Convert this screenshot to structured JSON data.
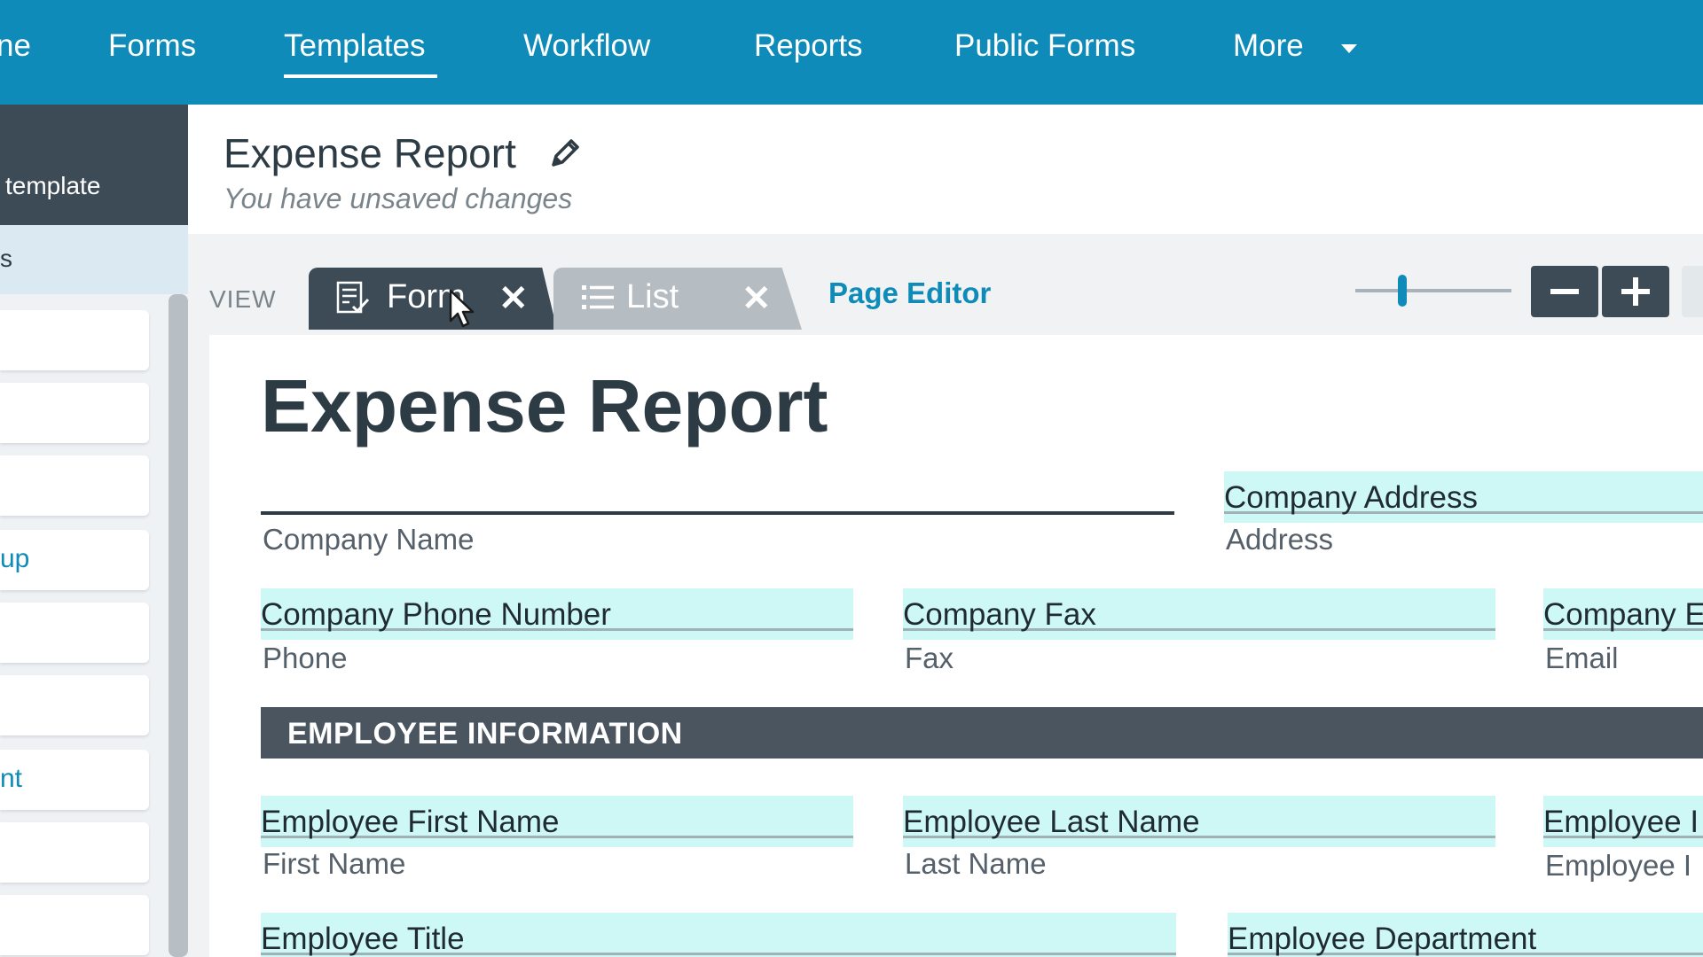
{
  "nav": {
    "items": [
      {
        "label": "ne"
      },
      {
        "label": "Forms"
      },
      {
        "label": "Templates"
      },
      {
        "label": "Workflow"
      },
      {
        "label": "Reports"
      },
      {
        "label": "Public Forms"
      },
      {
        "label": "More"
      }
    ],
    "active": "Templates"
  },
  "sidebar": {
    "header_label": "template",
    "selected_label": "s",
    "cards": [
      {
        "label": ""
      },
      {
        "label": ""
      },
      {
        "label": ""
      },
      {
        "label": "up"
      },
      {
        "label": ""
      },
      {
        "label": ""
      },
      {
        "label": "nt"
      },
      {
        "label": ""
      },
      {
        "label": ""
      }
    ]
  },
  "header": {
    "title": "Expense Report",
    "status": "You have unsaved changes"
  },
  "tabs": {
    "view_label": "VIEW",
    "form_label": "Form",
    "list_label": "List",
    "page_editor_label": "Page Editor",
    "zoom_level": 0.3
  },
  "form": {
    "title": "Expense Report",
    "company_name_label": "Company Name",
    "company_address_value": "Company Address",
    "company_address_label": "Address",
    "company_phone_value": "Company Phone Number",
    "company_phone_label": "Phone",
    "company_fax_value": "Company Fax",
    "company_fax_label": "Fax",
    "company_email_value": "Company E",
    "company_email_label": "Email",
    "section_employee": "EMPLOYEE INFORMATION",
    "emp_first_value": "Employee First Name",
    "emp_first_label": "First Name",
    "emp_last_value": "Employee Last Name",
    "emp_last_label": "Last Name",
    "emp_id_value": "Employee I",
    "emp_id_label": "Employee I",
    "emp_title_value": "Employee Title",
    "emp_dept_value": "Employee Department"
  },
  "colors": {
    "nav_bg": "#0e8bb9",
    "dark": "#3d4b56",
    "field_fill": "#cdf8f6",
    "accent": "#0e8bb9"
  }
}
